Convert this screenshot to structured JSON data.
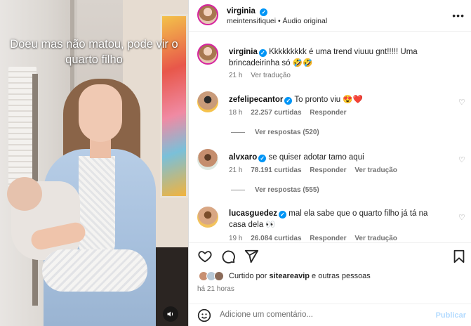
{
  "video": {
    "caption": "Doeu mas não matou, pode vir o quarto filho",
    "sound_icon": "speaker-icon"
  },
  "header": {
    "username": "virginia",
    "verified": true,
    "audio": "meintensifiquei • Áudio original",
    "more_icon": "more-horizontal-icon"
  },
  "caption_comment": {
    "username": "virginia",
    "text": "Kkkkkkkkk é uma trend viuuu gnt!!!!! Uma brincadeirinha só 🤣🤣",
    "time": "21 h",
    "translate": "Ver tradução"
  },
  "comments": [
    {
      "username": "zefelipecantor",
      "text": "To pronto viu 😍❤️",
      "time": "18 h",
      "likes": "22.257 curtidas",
      "reply": "Responder",
      "translate": "",
      "replies": "Ver respostas (520)"
    },
    {
      "username": "alvxaro",
      "text": "se quiser adotar tamo aqui",
      "time": "21 h",
      "likes": "78.191 curtidas",
      "reply": "Responder",
      "translate": "Ver tradução",
      "replies": "Ver respostas (555)"
    },
    {
      "username": "lucasguedez",
      "text": "mal ela sabe que o quarto filho já tá na casa dela 👀",
      "time": "19 h",
      "likes": "26.084 curtidas",
      "reply": "Responder",
      "translate": "Ver tradução",
      "replies": ""
    }
  ],
  "actions": {
    "like_icon": "heart-icon",
    "comment_icon": "comment-icon",
    "share_icon": "send-icon",
    "save_icon": "bookmark-icon"
  },
  "likes_summary": {
    "prefix": "Curtido por",
    "user": "siteareavip",
    "suffix": "e outras pessoas",
    "time_ago": "há 21 horas"
  },
  "add_comment": {
    "placeholder": "Adicione um comentário...",
    "publish": "Publicar",
    "emoji_icon": "emoji-icon"
  },
  "colors": {
    "verified": "#0095f6",
    "publish_disabled": "#b3dbff",
    "heart_red": "#ed4956"
  }
}
